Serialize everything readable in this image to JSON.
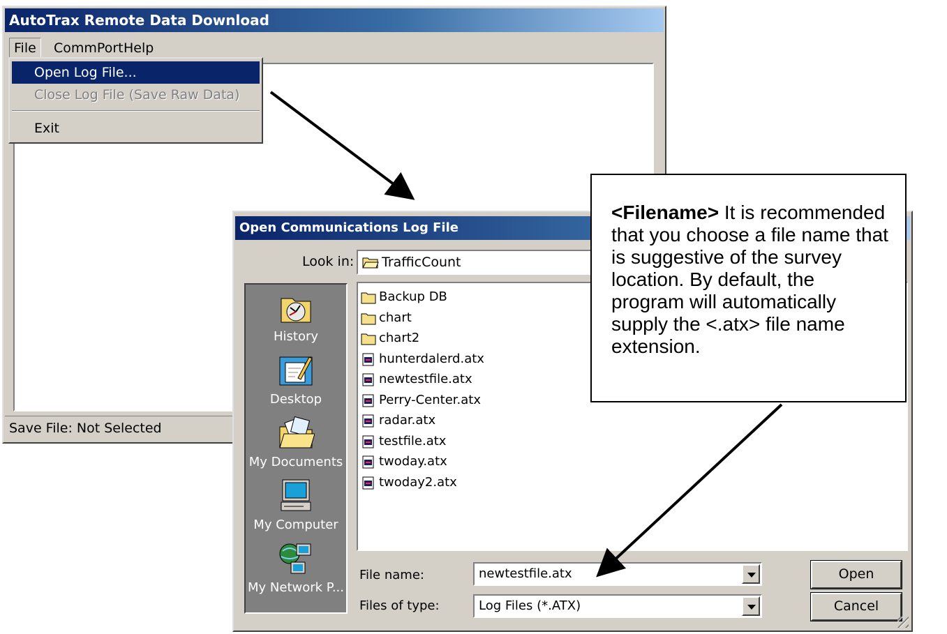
{
  "main_window": {
    "title": "AutoTrax Remote Data Download",
    "menu": [
      "File",
      "CommPort",
      "Help"
    ],
    "file_menu": {
      "open": "Open Log File...",
      "close": "Close Log File (Save Raw Data)",
      "exit": "Exit"
    },
    "status": "Save File: Not Selected"
  },
  "dialog": {
    "title": "Open Communications Log File",
    "look_in_label": "Look in:",
    "look_in_value": "TrafficCount",
    "places": [
      "History",
      "Desktop",
      "My Documents",
      "My Computer",
      "My Network P..."
    ],
    "files": [
      {
        "name": "Backup DB",
        "type": "folder"
      },
      {
        "name": "chart",
        "type": "folder"
      },
      {
        "name": "chart2",
        "type": "folder"
      },
      {
        "name": "hunterdalerd.atx",
        "type": "file"
      },
      {
        "name": "newtestfile.atx",
        "type": "file"
      },
      {
        "name": "Perry-Center.atx",
        "type": "file"
      },
      {
        "name": "radar.atx",
        "type": "file"
      },
      {
        "name": "testfile.atx",
        "type": "file"
      },
      {
        "name": "twoday.atx",
        "type": "file"
      },
      {
        "name": "twoday2.atx",
        "type": "file"
      }
    ],
    "file_name_label": "File name:",
    "file_name_value": "newtestfile.atx",
    "file_type_label": "Files of type:",
    "file_type_value": "Log Files (*.ATX)",
    "open_button": "Open",
    "cancel_button": "Cancel"
  },
  "callout": {
    "heading": "<Filename>",
    "body": " It is recommended that you choose a file name that is suggestive of the survey location. By default, the program will automatically supply  the <.atx> file name extension."
  }
}
